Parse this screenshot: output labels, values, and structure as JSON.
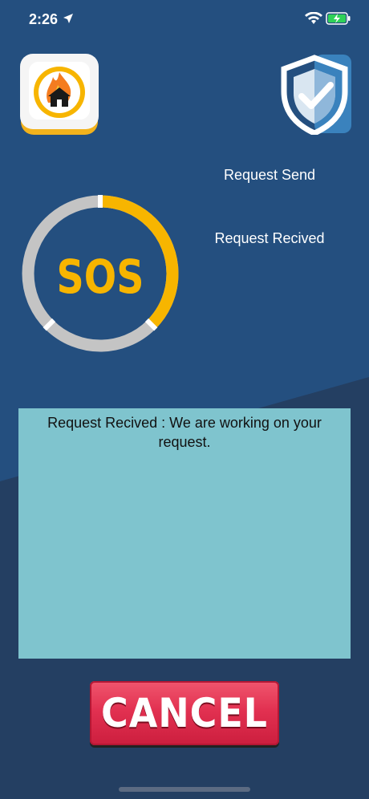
{
  "status_bar": {
    "time": "2:26",
    "icons": [
      "location-arrow-icon",
      "wifi-icon",
      "battery-charging-icon"
    ]
  },
  "logos": {
    "app": "fire-house-icon",
    "shield": "shield-check-icon"
  },
  "status_steps": {
    "sent": "Request Send",
    "received": "Request Recived"
  },
  "sos": {
    "label": "SOS",
    "progress": 0.375
  },
  "message": {
    "text": "Request Recived : We are working on your request."
  },
  "cancel_button": {
    "label": "CANCEL"
  },
  "colors": {
    "background": "#244f7f",
    "panel": "#7fc4ce",
    "accent": "#f7b500",
    "ring": "#c4c4c4",
    "cancel": "#e23151"
  }
}
